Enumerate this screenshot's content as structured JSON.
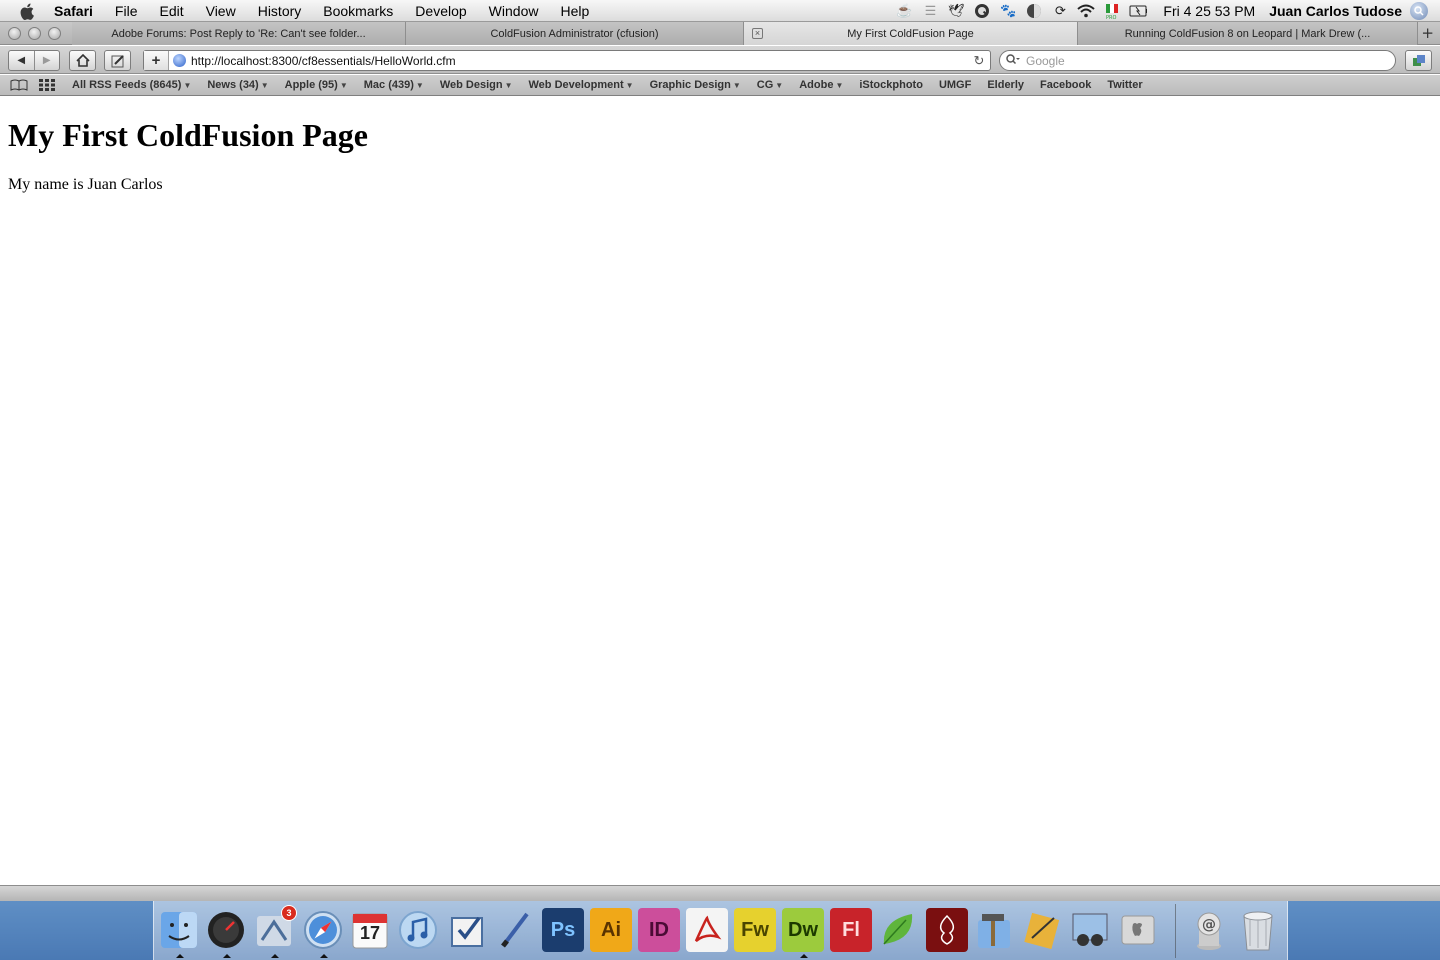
{
  "menubar": {
    "app_name": "Safari",
    "items": [
      "File",
      "Edit",
      "View",
      "History",
      "Bookmarks",
      "Develop",
      "Window",
      "Help"
    ],
    "clock": "Fri 4 25 53 PM",
    "user": "Juan Carlos Tudose"
  },
  "tabs": [
    {
      "label": "Adobe Forums: Post Reply to 'Re: Can't see folder...",
      "active": false
    },
    {
      "label": "ColdFusion Administrator (cfusion)",
      "active": false
    },
    {
      "label": "My First ColdFusion Page",
      "active": true
    },
    {
      "label": "Running ColdFusion 8 on Leopard | Mark Drew (...",
      "active": false
    }
  ],
  "toolbar": {
    "url": "http://localhost:8300/cf8essentials/HelloWorld.cfm",
    "search_placeholder": "Google"
  },
  "bookmarks": [
    {
      "label": "All RSS Feeds (8645)",
      "menu": true
    },
    {
      "label": "News (34)",
      "menu": true
    },
    {
      "label": "Apple (95)",
      "menu": true
    },
    {
      "label": "Mac (439)",
      "menu": true
    },
    {
      "label": "Web Design",
      "menu": true
    },
    {
      "label": "Web Development",
      "menu": true
    },
    {
      "label": "Graphic Design",
      "menu": true
    },
    {
      "label": "CG",
      "menu": true
    },
    {
      "label": "Adobe",
      "menu": true
    },
    {
      "label": "iStockphoto",
      "menu": false
    },
    {
      "label": "UMGF",
      "menu": false
    },
    {
      "label": "Elderly",
      "menu": false
    },
    {
      "label": "Facebook",
      "menu": false
    },
    {
      "label": "Twitter",
      "menu": false
    }
  ],
  "page": {
    "heading": "My First ColdFusion Page",
    "text": "My name is Juan Carlos"
  },
  "dock": {
    "mail_badge": "3",
    "calendar_day": "17",
    "app_labels": [
      "Ps",
      "Ai",
      "ID",
      "Fw",
      "Dw",
      "Fl"
    ]
  }
}
